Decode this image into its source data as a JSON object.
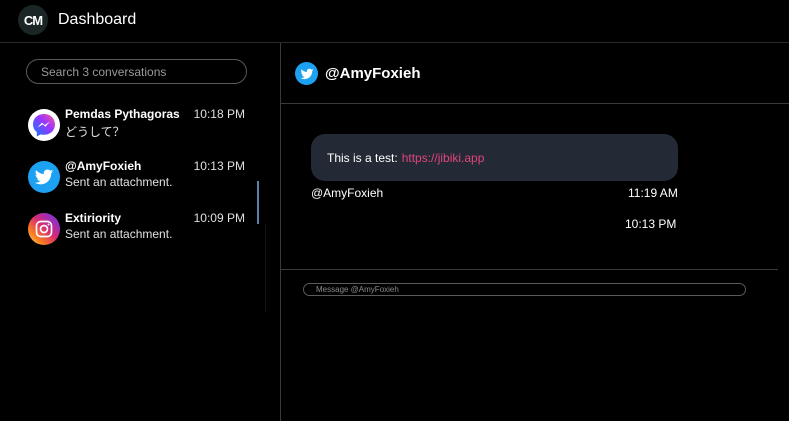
{
  "header": {
    "logo_text": "CM",
    "title": "Dashboard"
  },
  "sidebar": {
    "search_placeholder": "Search 3 conversations",
    "conversations": [
      {
        "name": "Pemdas Pythagoras",
        "time": "10:18 PM",
        "preview": "どうして？",
        "platform": "messenger-icon"
      },
      {
        "name": "@AmyFoxieh",
        "time": "10:13 PM",
        "preview": "Sent an attachment.",
        "platform": "twitter-icon"
      },
      {
        "name": "Extiriority",
        "time": "10:09 PM",
        "preview": "Sent an attachment.",
        "platform": "instagram-icon"
      }
    ]
  },
  "chat": {
    "title": "@AmyFoxieh",
    "platform": "twitter-icon",
    "messages": [
      {
        "text": "This is a test:",
        "link": "https://jibiki.app",
        "author": "@AmyFoxieh",
        "time": "11:19 AM"
      }
    ],
    "extra_time": "10:13 PM",
    "composer_placeholder": "Message @AmyFoxieh"
  },
  "colors": {
    "background": "#000000",
    "bubble": "#232a35",
    "link": "#e0457b",
    "twitter": "#1da1f2",
    "scroll_accent": "#5a7fa8"
  }
}
